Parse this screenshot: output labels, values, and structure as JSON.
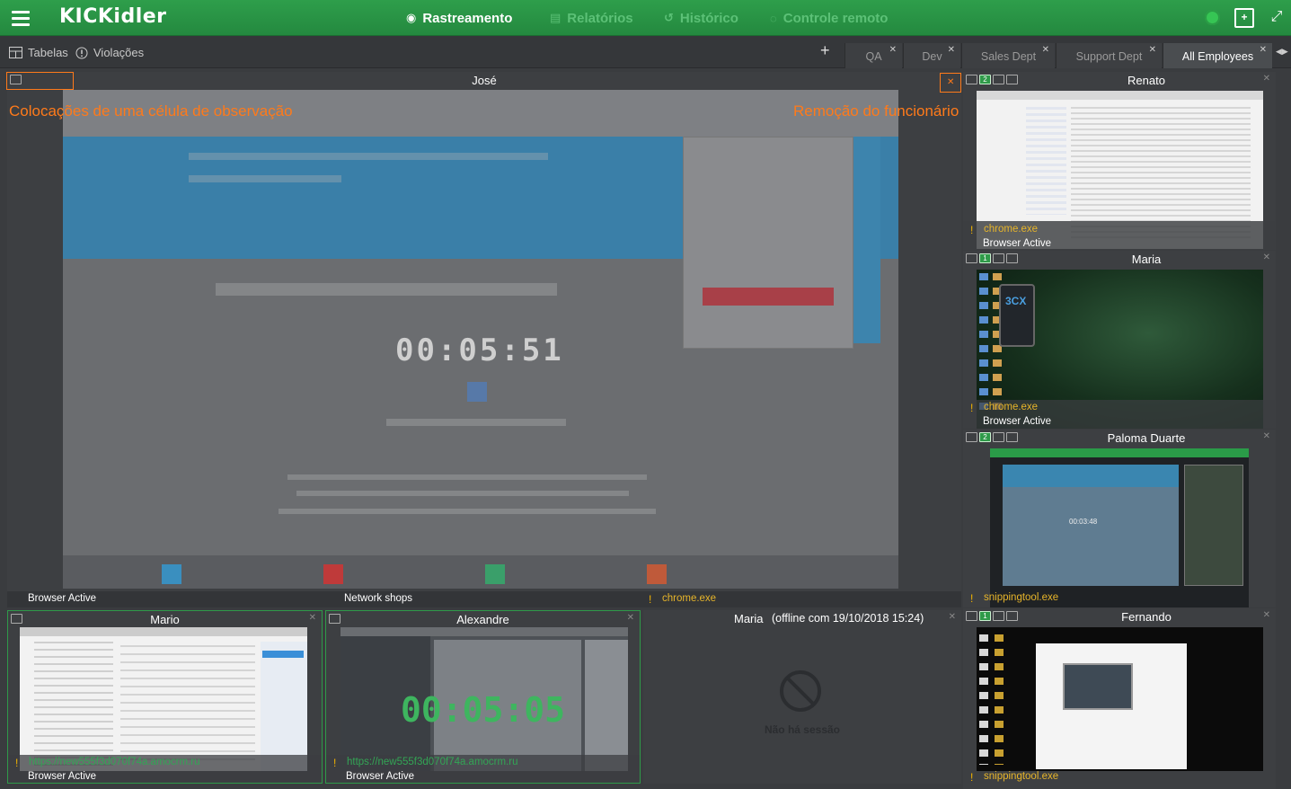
{
  "app": {
    "logo": "KICKidler",
    "nav": [
      {
        "label": "Rastreamento",
        "icon": "eye-icon",
        "active": true
      },
      {
        "label": "Relatórios",
        "icon": "document-icon",
        "active": false
      },
      {
        "label": "Histórico",
        "icon": "history-icon",
        "active": false
      },
      {
        "label": "Controle remoto",
        "icon": "remote-icon",
        "active": false
      }
    ]
  },
  "subbar": {
    "tables_label": "Tabelas",
    "violations_label": "Violações",
    "tabs": [
      {
        "label": "QA",
        "active": false
      },
      {
        "label": "Dev",
        "active": false
      },
      {
        "label": "Sales Dept",
        "active": false
      },
      {
        "label": "Support Dept",
        "active": false
      },
      {
        "label": "All Employees",
        "active": true
      }
    ]
  },
  "annotations": {
    "left": "Colocações de uma célula de observação",
    "right": "Remoção do funcionário"
  },
  "main": {
    "title": "José",
    "timer": "00:05:51",
    "state_left": "Browser Active",
    "state_mid": "Network shops",
    "warn": "!",
    "process": "chrome.exe"
  },
  "cells": {
    "renato": {
      "name": "Renato",
      "monitor": "2",
      "process": "chrome.exe",
      "state": "Browser Active"
    },
    "maria1": {
      "name": "Maria",
      "monitor": "1",
      "process": "chrome.exe",
      "state": "Browser Active",
      "app_label": "3CX"
    },
    "paloma": {
      "name": "Paloma Duarte",
      "monitor": "2",
      "process": "snippingtool.exe",
      "timer": "00:03:48"
    },
    "fernando": {
      "name": "Fernando",
      "monitor": "1",
      "process": "snippingtool.exe"
    },
    "mario": {
      "name": "Mario",
      "url": "https://new555f3d070f74a.amocrm.ru",
      "state": "Browser Active"
    },
    "alexandre": {
      "name": "Alexandre",
      "timer": "00:05:05",
      "url": "https://new555f3d070f74a.amocrm.ru",
      "state": "Browser Active"
    },
    "maria2": {
      "name": "Maria",
      "offline": "(offline com 19/10/2018 15:24)",
      "no_session": "Não há sessão"
    }
  },
  "colors": {
    "brand_green": "#2e9e4b",
    "accent_orange": "#ff7a1a",
    "warn_yellow": "#f4b400"
  }
}
